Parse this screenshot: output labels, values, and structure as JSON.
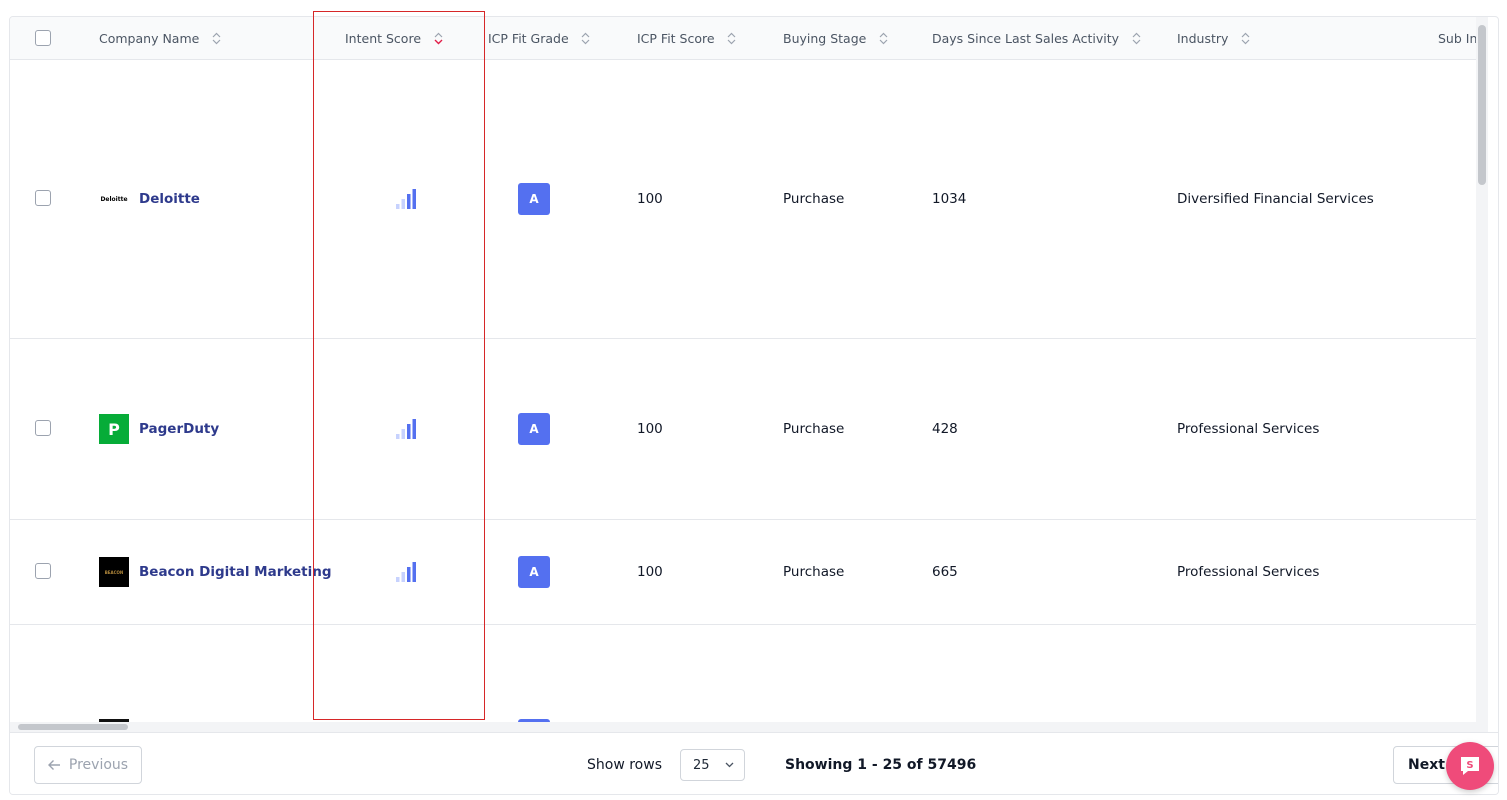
{
  "header": {
    "columns": [
      {
        "key": "company",
        "label": "Company Name"
      },
      {
        "key": "intent",
        "label": "Intent Score"
      },
      {
        "key": "grade",
        "label": "ICP Fit Grade"
      },
      {
        "key": "score",
        "label": "ICP Fit Score"
      },
      {
        "key": "stage",
        "label": "Buying Stage"
      },
      {
        "key": "days",
        "label": "Days Since Last Sales Activity"
      },
      {
        "key": "industry",
        "label": "Industry"
      },
      {
        "key": "subindustry",
        "label": "Sub Indu"
      }
    ]
  },
  "rows": [
    {
      "company": "Deloitte",
      "logo_text": "Deloitte",
      "logo_icon": "deloitte-logo",
      "intent_bars": 4,
      "intent_active": 2,
      "grade": "A",
      "score": "100",
      "stage": "Purchase",
      "days": "1034",
      "industry": "Diversified Financial Services"
    },
    {
      "company": "PagerDuty",
      "logo_text": "P",
      "logo_icon": "pagerduty-logo",
      "intent_bars": 4,
      "intent_active": 2,
      "grade": "A",
      "score": "100",
      "stage": "Purchase",
      "days": "428",
      "industry": "Professional Services"
    },
    {
      "company": "Beacon Digital Marketing",
      "logo_text": "BEACON",
      "logo_icon": "beacon-logo",
      "intent_bars": 4,
      "intent_active": 2,
      "grade": "A",
      "score": "100",
      "stage": "Purchase",
      "days": "665",
      "industry": "Professional Services"
    }
  ],
  "footer": {
    "previous_label": "Previous",
    "next_label": "Next",
    "show_rows_label": "Show rows",
    "rows_per_page": "25",
    "showing_text": "Showing 1 - 25 of 57496"
  },
  "colors": {
    "accent": "#5470f0",
    "link": "#2e3a8c",
    "highlight": "#d62728",
    "chat": "#ef4b7a",
    "pagerduty": "#06ac38"
  },
  "icons": {
    "sort": "sort-icon",
    "sort_active": "sort-desc-icon",
    "intent": "signal-bars-icon",
    "arrow_left": "arrow-left-icon",
    "chevron": "chevron-down-icon",
    "chat": "chat-icon"
  }
}
